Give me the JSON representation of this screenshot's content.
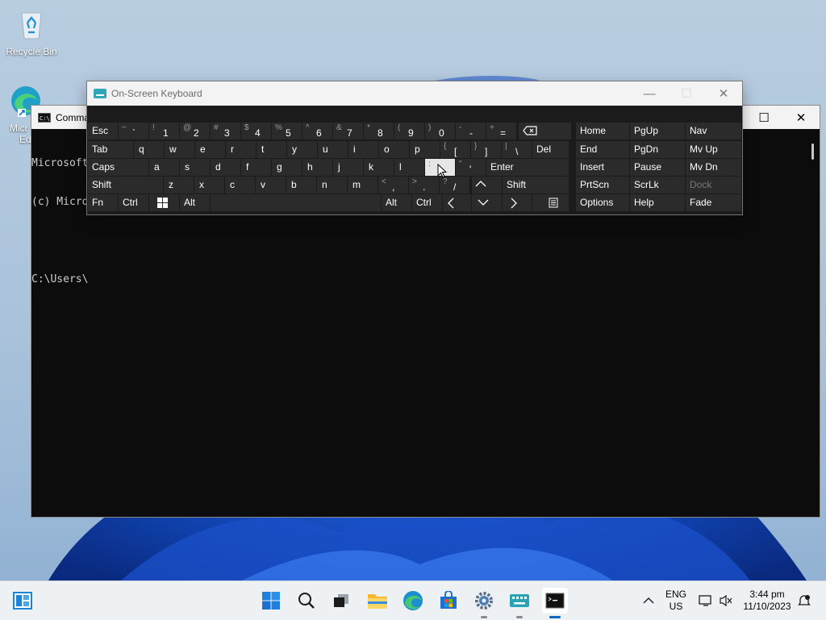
{
  "desktop": {
    "recycle_bin_label": "Recycle Bin",
    "edge_label_line1": "Micr",
    "edge_label_line2": "Ed"
  },
  "cmd": {
    "title": "Comma",
    "lines": [
      "Microsoft",
      "(c) Micro",
      "",
      "C:\\Users\\"
    ],
    "controls": {
      "maximize": "☐",
      "close": "✕"
    }
  },
  "osk": {
    "title": "On-Screen Keyboard",
    "controls": {
      "minimize": "—",
      "maximize": "☐",
      "close": "✕"
    },
    "number_row": [
      {
        "shift": "~",
        "main": "`"
      },
      {
        "shift": "!",
        "main": "1"
      },
      {
        "shift": "@",
        "main": "2"
      },
      {
        "shift": "#",
        "main": "3"
      },
      {
        "shift": "$",
        "main": "4"
      },
      {
        "shift": "%",
        "main": "5"
      },
      {
        "shift": "^",
        "main": "6"
      },
      {
        "shift": "&",
        "main": "7"
      },
      {
        "shift": "*",
        "main": "8"
      },
      {
        "shift": "(",
        "main": "9"
      },
      {
        "shift": ")",
        "main": "0"
      },
      {
        "shift": "-",
        "main": "-"
      },
      {
        "shift": "+",
        "main": "="
      }
    ],
    "letters_row1": [
      "q",
      "w",
      "e",
      "r",
      "t",
      "y",
      "u",
      "i",
      "o",
      "p"
    ],
    "bracket_keys": [
      {
        "shift": "{",
        "main": "["
      },
      {
        "shift": "}",
        "main": "]"
      },
      {
        "shift": "|",
        "main": "\\"
      }
    ],
    "letters_row2": [
      "a",
      "s",
      "d",
      "f",
      "g",
      "h",
      "j",
      "k",
      "l"
    ],
    "semicolon_key": {
      "shift": ":",
      "main": ";"
    },
    "quote_key": {
      "shift": "\"",
      "main": "'"
    },
    "letters_row3": [
      "z",
      "x",
      "c",
      "v",
      "b",
      "n",
      "m"
    ],
    "punct_row3": [
      {
        "shift": "<",
        "main": ","
      },
      {
        "shift": ">",
        "main": "."
      },
      {
        "shift": "?",
        "main": "/"
      }
    ],
    "mod": {
      "esc": "Esc",
      "tab": "Tab",
      "caps": "Caps",
      "shift_left": "Shift",
      "shift_right": "Shift",
      "fn": "Fn",
      "ctrl_left": "Ctrl",
      "alt_left": "Alt",
      "alt_right": "Alt",
      "ctrl_right": "Ctrl",
      "del": "Del",
      "enter": "Enter"
    },
    "nav_keys": [
      [
        "Home",
        "PgUp",
        "Nav"
      ],
      [
        "End",
        "PgDn",
        "Mv Up"
      ],
      [
        "Insert",
        "Pause",
        "Mv Dn"
      ],
      [
        "PrtScn",
        "ScrLk",
        "Dock"
      ],
      [
        "Options",
        "Help",
        "Fade"
      ]
    ],
    "highlighted_key": ";"
  },
  "taskbar": {
    "apps": [
      "start-icon",
      "search-icon",
      "task-view-icon",
      "file-explorer-icon",
      "edge-icon",
      "store-icon",
      "settings-icon",
      "osk-icon",
      "terminal-icon"
    ],
    "lang_line1": "ENG",
    "lang_line2": "US",
    "time": "3:44 pm",
    "date": "11/10/2023"
  }
}
